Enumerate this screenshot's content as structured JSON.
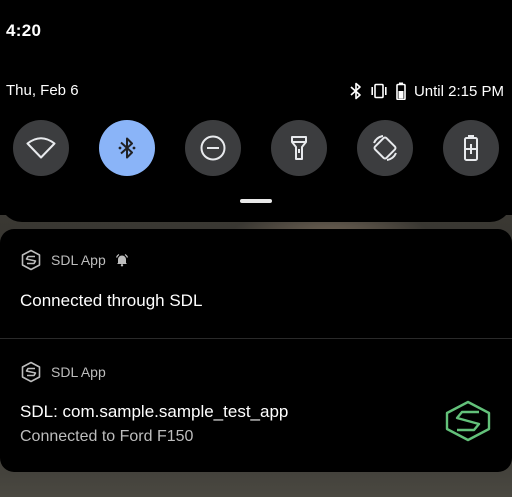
{
  "status_bar": {
    "time": "4:20"
  },
  "quick_settings": {
    "date": "Thu, Feb 6",
    "battery_text": "Until 2:15 PM",
    "tiles": [
      {
        "name": "wifi",
        "icon": "wifi-icon",
        "active": false
      },
      {
        "name": "bluetooth",
        "icon": "bluetooth-icon",
        "active": true
      },
      {
        "name": "do-not-disturb",
        "icon": "do-not-disturb-icon",
        "active": false
      },
      {
        "name": "flashlight",
        "icon": "flashlight-icon",
        "active": false
      },
      {
        "name": "auto-rotate",
        "icon": "auto-rotate-icon",
        "active": false
      },
      {
        "name": "battery-saver",
        "icon": "battery-saver-icon",
        "active": false
      }
    ],
    "colors": {
      "active_tile": "#8ab4f8",
      "inactive_tile": "#3c3d3f"
    }
  },
  "notifications": [
    {
      "app_name": "SDL App",
      "title": "Connected through SDL",
      "has_alert_icon": true
    },
    {
      "app_name": "SDL App",
      "title": "SDL: com.sample.sample_test_app",
      "text": "Connected to Ford F150",
      "large_icon": "sdl-logo-icon",
      "accent_color": "#63c17a"
    }
  ]
}
